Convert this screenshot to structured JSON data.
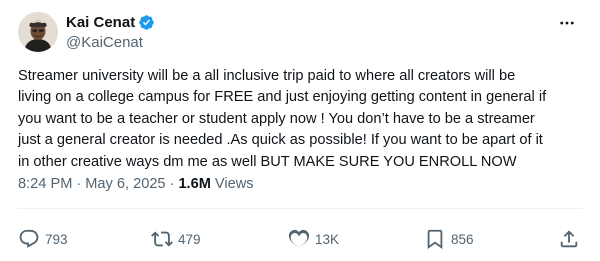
{
  "author": {
    "display_name": "Kai Cenat",
    "handle": "@KaiCenat",
    "verified": true
  },
  "tweet": {
    "lines": [
      "Streamer university will be a all inclusive trip paid to where all creators will be",
      "living on a college campus for FREE and just enjoying getting content in general if",
      "you want to be a teacher or student apply now ! You don’t have to be a streamer",
      "just a general creator is needed .As quick as possible! If you want to be apart of it",
      "in other creative ways dm me as well BUT MAKE SURE YOU ENROLL NOW"
    ],
    "time": "8:24 PM",
    "separator": "·",
    "date": "May 6, 2025",
    "views_count": "1.6M",
    "views_label": "Views"
  },
  "actions": {
    "replies": "793",
    "reposts": "479",
    "likes": "13K",
    "bookmarks": "856"
  },
  "icons": {
    "verified": "verified-badge-icon",
    "more": "more-options-icon",
    "reply": "reply-bubble-icon",
    "repost": "repost-arrows-icon",
    "like": "heart-icon",
    "bookmark": "bookmark-icon",
    "share": "share-upload-icon"
  },
  "colors": {
    "verified": "#1d9bf0",
    "text": "#0f1419",
    "secondary": "#536471"
  }
}
